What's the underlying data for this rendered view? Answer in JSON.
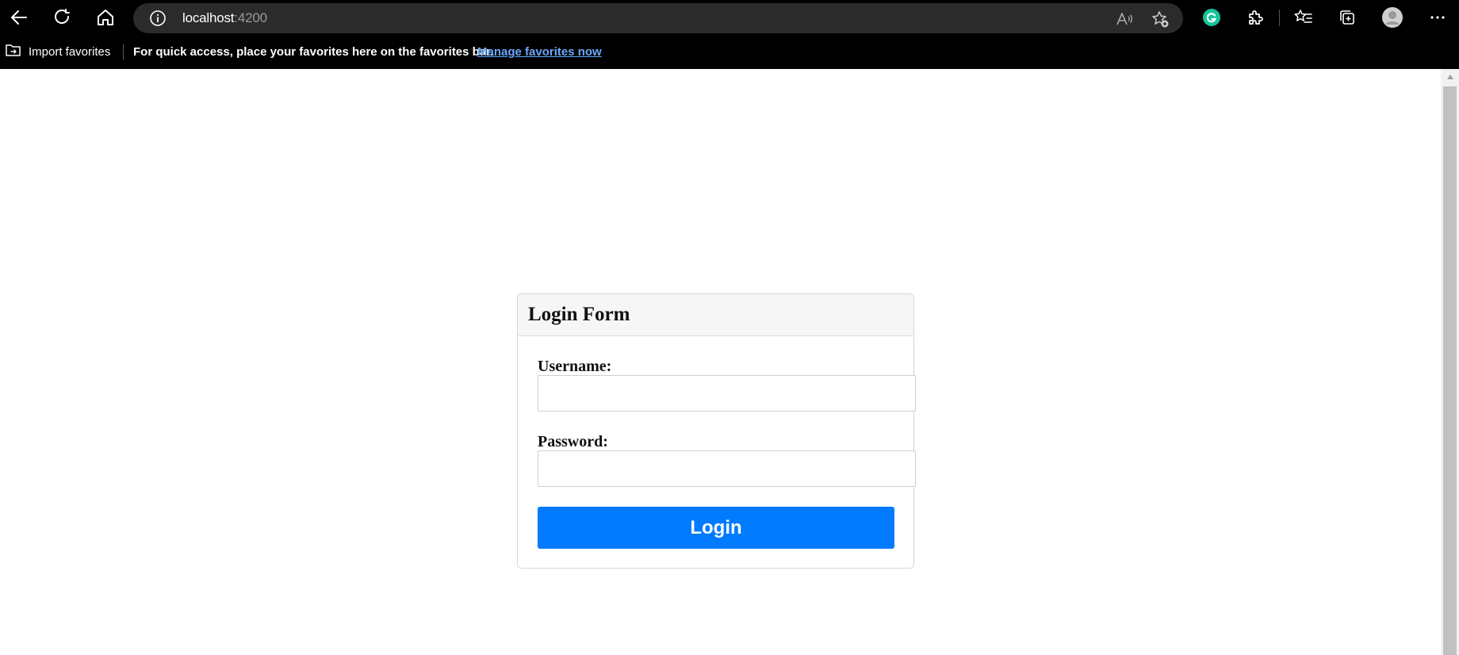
{
  "browser": {
    "address_bar": {
      "host": "localhost",
      "port": ":4200"
    },
    "icons": [
      "back-icon",
      "refresh-icon",
      "home-icon",
      "site-info-icon",
      "read-aloud-icon",
      "add-favorite-icon",
      "grammarly-icon",
      "extensions-icon",
      "favorites-icon",
      "collections-icon",
      "profile-icon",
      "more-icon"
    ]
  },
  "favorites_bar": {
    "import_label": "Import favorites",
    "message": "For quick access, place your favorites here on the favorites bar.",
    "manage_link": "Manage favorites now"
  },
  "login_form": {
    "title": "Login Form",
    "username_label": "Username:",
    "username_value": "",
    "password_label": "Password:",
    "password_value": "",
    "submit_label": "Login"
  },
  "colors": {
    "button_primary": "#007bff",
    "link": "#6aa8ff",
    "grammarly": "#15c39a"
  }
}
